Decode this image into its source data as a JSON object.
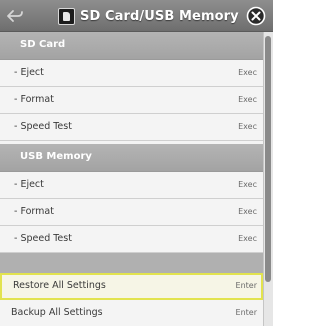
{
  "window": {
    "title": "SD Card/USB Memory"
  },
  "sections": [
    {
      "title": "SD Card",
      "items": [
        {
          "label": "- Eject",
          "action": "Exec"
        },
        {
          "label": "- Format",
          "action": "Exec"
        },
        {
          "label": "- Speed Test",
          "action": "Exec"
        }
      ]
    },
    {
      "title": "USB Memory",
      "items": [
        {
          "label": "- Eject",
          "action": "Exec"
        },
        {
          "label": "- Format",
          "action": "Exec"
        },
        {
          "label": "- Speed Test",
          "action": "Exec"
        }
      ]
    }
  ],
  "settings": [
    {
      "label": "Restore All Settings",
      "action": "Enter",
      "highlighted": true
    },
    {
      "label": "Backup All Settings",
      "action": "Enter",
      "highlighted": false
    }
  ],
  "colors": {
    "highlight_border": "#e2e34e",
    "header": "#7a7a7a"
  }
}
